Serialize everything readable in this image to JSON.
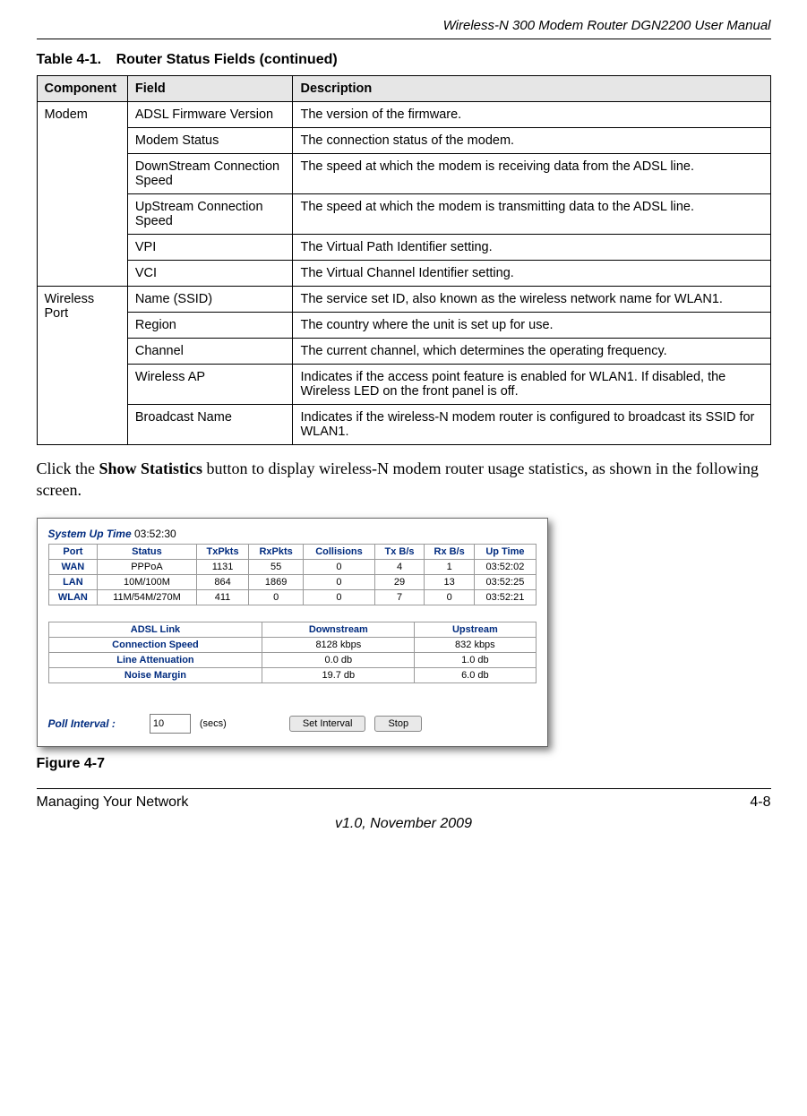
{
  "header": {
    "running": "Wireless-N 300 Modem Router DGN2200 User Manual"
  },
  "table_caption": {
    "number": "Table 4-1.",
    "title": "Router Status Fields  (continued)"
  },
  "status_table": {
    "headers": [
      "Component",
      "Field",
      "Description"
    ],
    "groups": [
      {
        "component": "Modem",
        "rows": [
          {
            "field": "ADSL Firmware Version",
            "desc": "The version of the firmware."
          },
          {
            "field": "Modem Status",
            "desc": "The connection status of the modem."
          },
          {
            "field": "DownStream Connection Speed",
            "desc": "The speed at which the modem is receiving data from the ADSL line."
          },
          {
            "field": "UpStream Connection Speed",
            "desc": "The speed at which the modem is transmitting data to the ADSL line."
          },
          {
            "field": "VPI",
            "desc": "The Virtual Path Identifier setting."
          },
          {
            "field": "VCI",
            "desc": "The Virtual Channel Identifier setting."
          }
        ]
      },
      {
        "component": "Wireless Port",
        "rows": [
          {
            "field": "Name (SSID)",
            "desc": "The service set ID, also known as the wireless network name for WLAN1."
          },
          {
            "field": "Region",
            "desc": "The country where the unit is set up for use."
          },
          {
            "field": "Channel",
            "desc": "The current channel, which determines the operating frequency."
          },
          {
            "field": "Wireless AP",
            "desc": "Indicates if the access point feature is enabled for WLAN1. If disabled, the Wireless LED on the front panel is off."
          },
          {
            "field": "Broadcast Name",
            "desc": "Indicates if the wireless-N modem router is configured to broadcast its SSID for WLAN1."
          }
        ]
      }
    ]
  },
  "body_paragraph": {
    "pre": "Click the ",
    "bold": "Show Statistics",
    "post": " button to display wireless-N modem router usage statistics, as shown in the following screen."
  },
  "stats": {
    "system_up_label": "System Up Time",
    "system_up_value": "03:52:30",
    "grid1": {
      "headers": [
        "Port",
        "Status",
        "TxPkts",
        "RxPkts",
        "Collisions",
        "Tx B/s",
        "Rx B/s",
        "Up Time"
      ],
      "rows": [
        [
          "WAN",
          "PPPoA",
          "1131",
          "55",
          "0",
          "4",
          "1",
          "03:52:02"
        ],
        [
          "LAN",
          "10M/100M",
          "864",
          "1869",
          "0",
          "29",
          "13",
          "03:52:25"
        ],
        [
          "WLAN",
          "11M/54M/270M",
          "411",
          "0",
          "0",
          "7",
          "0",
          "03:52:21"
        ]
      ]
    },
    "grid2": {
      "headers": [
        "ADSL Link",
        "Downstream",
        "Upstream"
      ],
      "rows": [
        [
          "Connection Speed",
          "8128 kbps",
          "832 kbps"
        ],
        [
          "Line Attenuation",
          "0.0 db",
          "1.0 db"
        ],
        [
          "Noise Margin",
          "19.7 db",
          "6.0 db"
        ]
      ]
    },
    "poll": {
      "label": "Poll Interval :",
      "value": "10",
      "secs": "(secs)",
      "set_btn": "Set Interval",
      "stop_btn": "Stop"
    }
  },
  "figure_caption": "Figure 4-7",
  "footer": {
    "left": "Managing Your Network",
    "right": "4-8",
    "version": "v1.0, November 2009"
  }
}
